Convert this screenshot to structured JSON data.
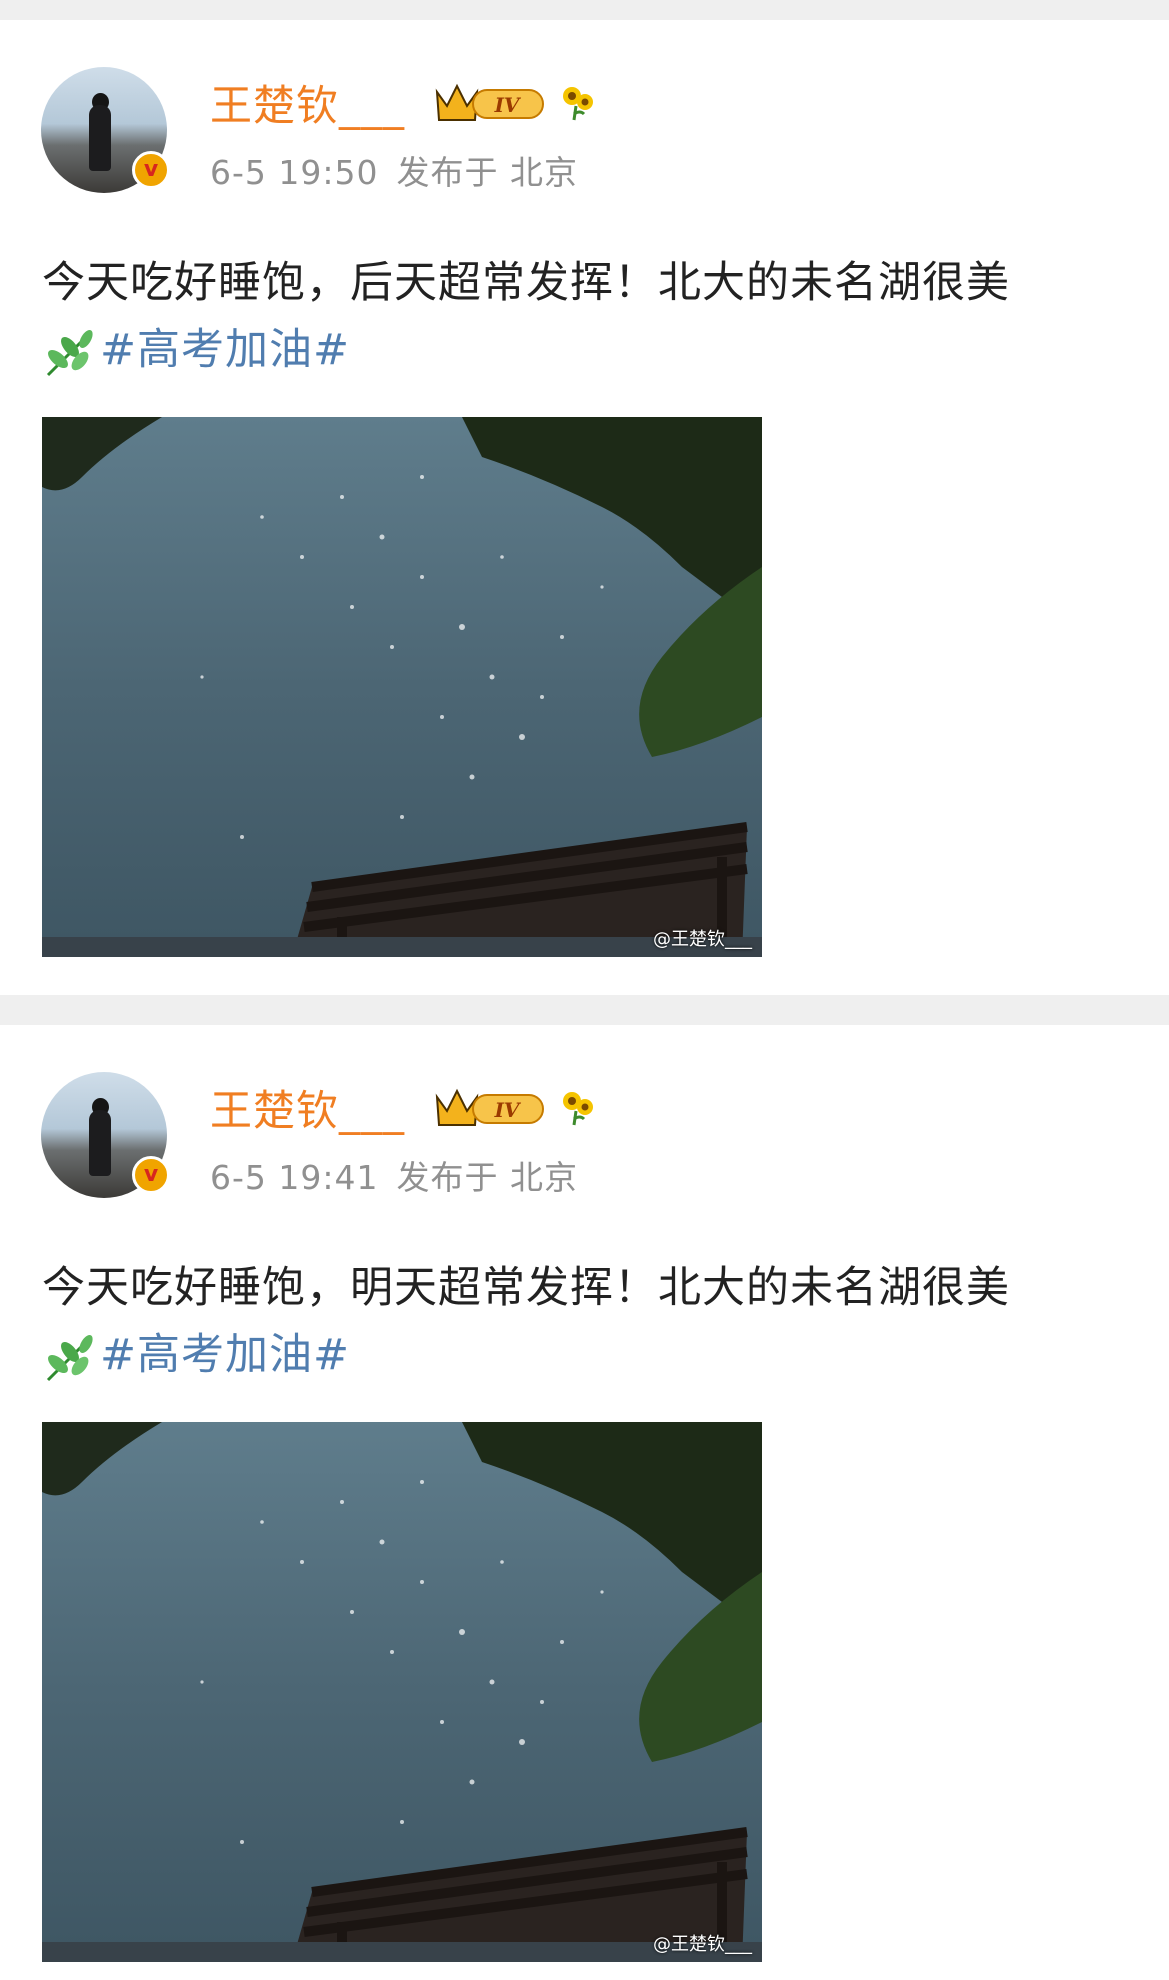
{
  "posts": [
    {
      "username": "王楚钦___",
      "level_badge": "IV",
      "verified_mark": "v",
      "time": "6-5 19:50",
      "location": "发布于 北京",
      "text": "今天吃好睡饱，后天超常发挥！北大的未名湖很美",
      "hashtag": "#高考加油#",
      "watermark": "@王楚钦___",
      "icons": {
        "emoji": "herb-leaf-icon",
        "crown": "crown-icon",
        "flower": "sunflower-icon"
      }
    },
    {
      "username": "王楚钦___",
      "level_badge": "IV",
      "verified_mark": "v",
      "time": "6-5 19:41",
      "location": "发布于 北京",
      "text": "今天吃好睡饱，明天超常发挥！北大的未名湖很美",
      "hashtag": "#高考加油#",
      "watermark": "@王楚钦___",
      "icons": {
        "emoji": "herb-leaf-icon",
        "crown": "crown-icon",
        "flower": "sunflower-icon"
      }
    }
  ],
  "colors": {
    "username": "#f07e22",
    "hashtag": "#507daf",
    "meta": "#909090",
    "background": "#efefef"
  }
}
